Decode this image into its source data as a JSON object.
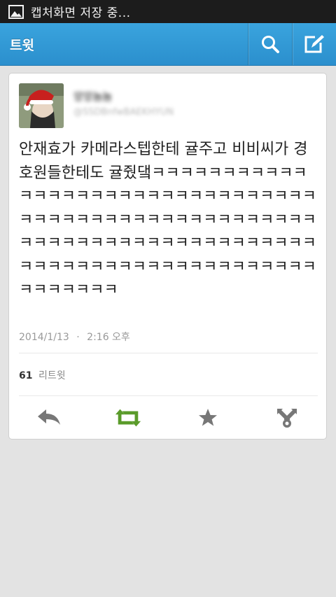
{
  "status_bar": {
    "notification_icon": "image-icon",
    "text": "캡처화면 저장 중..."
  },
  "action_bar": {
    "title": "트윗",
    "search_icon": "search-icon",
    "compose_icon": "compose-icon",
    "color": "#2f97d4"
  },
  "tweet": {
    "avatar_icon": "avatar-image",
    "display_name": "앙앙뇸뇸",
    "handle": "@SSDBnfwBAEKHYUN",
    "text": "안재효가 카메라스텝한테 귤주고 비비씨가 경호원들한테도 귤줬댘ㅋㅋㅋㅋㅋㅋㅋㅋㅋㅋㅋㅋㅋㅋㅋㅋㅋㅋㅋㅋㅋㅋㅋㅋㅋㅋㅋㅋㅋㅋㅋㅋㅋㅋㅋㅋㅋㅋㅋㅋㅋㅋㅋㅋㅋㅋㅋㅋㅋㅋㅋㅋㅋㅋㅋㅋㅋㅋㅋㅋㅋㅋㅋㅋㅋㅋㅋㅋㅋㅋㅋㅋㅋㅋㅋㅋㅋㅋㅋㅋㅋㅋㅋㅋㅋㅋㅋㅋㅋㅋㅋㅋㅋㅋㅋㅋㅋㅋㅋㅋㅋㅋ",
    "date": "2014/1/13",
    "separator": "·",
    "time": "2:16 오후",
    "retweet_count": "61",
    "retweet_label": "리트윗"
  },
  "actions": {
    "reply_icon": "reply-icon",
    "retweet_icon": "retweet-icon",
    "favorite_icon": "star-icon",
    "share_icon": "share-icon",
    "retweet_color": "#5a9b2a",
    "icon_color": "#777777"
  }
}
